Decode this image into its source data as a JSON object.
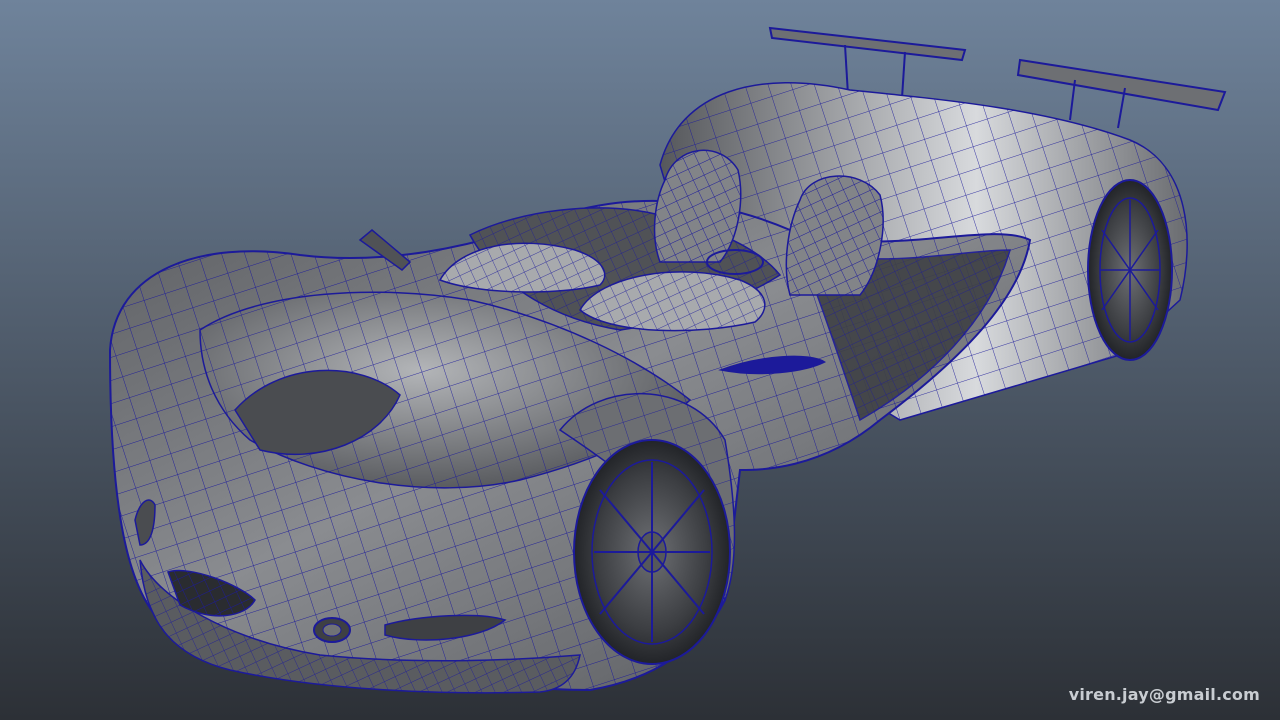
{
  "viewport": {
    "background_top": "#6f839b",
    "background_bottom": "#2c3036",
    "wire_color": "#1c1a9a",
    "body_shade": "#77797d",
    "body_highlight": "#d5d7da",
    "body_dark": "#3a3c40"
  },
  "model": {
    "subject": "wireframe race car",
    "icon": "car-wireframe-icon"
  },
  "watermark": {
    "text": "viren.jay@gmail.com"
  }
}
